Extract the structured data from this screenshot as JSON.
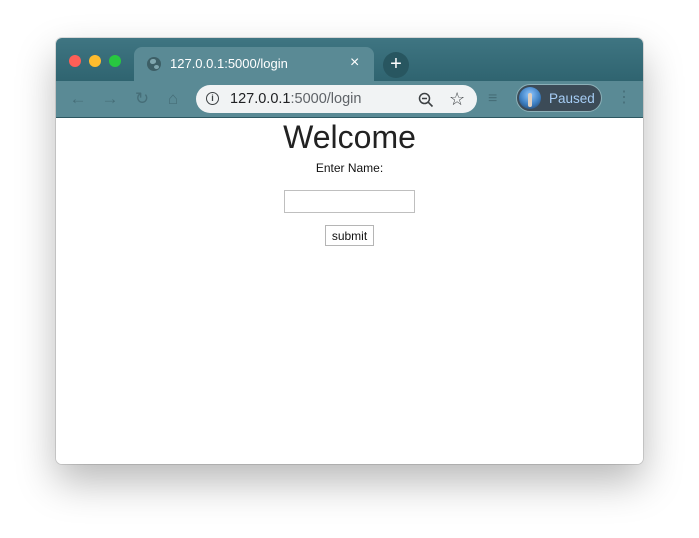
{
  "browser": {
    "tab": {
      "title": "127.0.0.1:5000/login",
      "close_glyph": "×"
    },
    "new_tab_glyph": "+",
    "address_bar": {
      "host": "127.0.0.1",
      "path": ":5000/login"
    },
    "profile": {
      "label": "Paused"
    },
    "icons": {
      "traffic_lights": [
        "close-window-icon",
        "minimize-window-icon",
        "maximize-window-icon"
      ],
      "tab_favicon": "globe-icon",
      "nav": [
        "back-icon",
        "forward-icon",
        "reload-icon",
        "home-icon"
      ],
      "omnibox": [
        "info-icon",
        "zoom-out-icon",
        "star-icon"
      ],
      "right": [
        "extensions-icon",
        "avatar",
        "more-menu-icon"
      ]
    },
    "colors": {
      "frame": "#2f6470",
      "tab_active": "#5a8a95",
      "profile_text": "#a6cdf5"
    }
  },
  "page": {
    "heading": "Welcome",
    "form": {
      "name_label": "Enter Name:",
      "name_value": "",
      "submit_label": "submit"
    }
  }
}
